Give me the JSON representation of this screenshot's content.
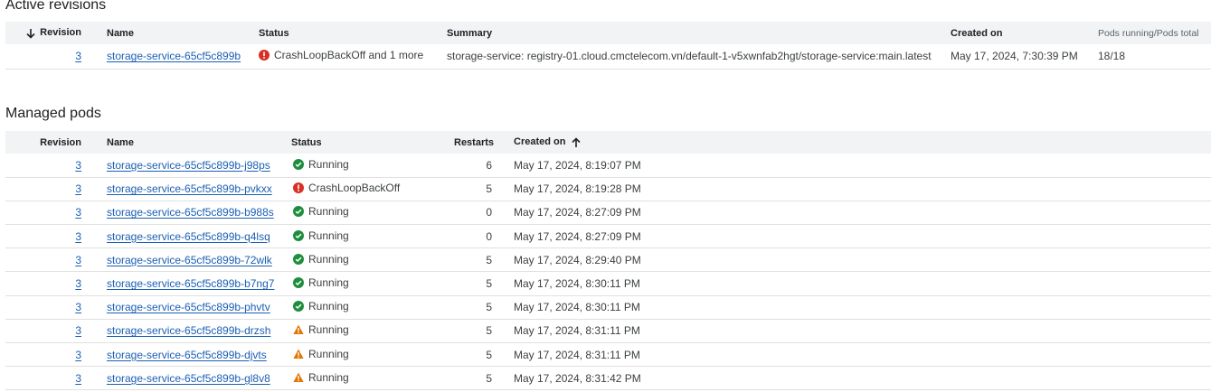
{
  "active_revisions": {
    "title": "Active revisions",
    "headers": {
      "revision": "Revision",
      "name": "Name",
      "status": "Status",
      "summary": "Summary",
      "created_on": "Created on",
      "pods": "Pods running/Pods total"
    },
    "rows": [
      {
        "revision": "3",
        "name": "storage-service-65cf5c899b",
        "status": "CrashLoopBackOff and 1 more",
        "status_icon": "error-icon",
        "summary": "storage-service: registry-01.cloud.cmctelecom.vn/default-1-v5xwnfab2hgt/storage-service:main.latest",
        "created_on": "May 17, 2024, 7:30:39 PM",
        "pods": "18/18"
      }
    ]
  },
  "managed_pods": {
    "title": "Managed pods",
    "headers": {
      "revision": "Revision",
      "name": "Name",
      "status": "Status",
      "restarts": "Restarts",
      "created_on": "Created on"
    },
    "rows": [
      {
        "revision": "3",
        "name": "storage-service-65cf5c899b-j98ps",
        "status": "Running",
        "status_icon": "check-circle-icon",
        "restarts": "6",
        "created_on": "May 17, 2024, 8:19:07 PM"
      },
      {
        "revision": "3",
        "name": "storage-service-65cf5c899b-pvkxx",
        "status": "CrashLoopBackOff",
        "status_icon": "error-icon",
        "restarts": "5",
        "created_on": "May 17, 2024, 8:19:28 PM"
      },
      {
        "revision": "3",
        "name": "storage-service-65cf5c899b-b988s",
        "status": "Running",
        "status_icon": "check-circle-icon",
        "restarts": "0",
        "created_on": "May 17, 2024, 8:27:09 PM"
      },
      {
        "revision": "3",
        "name": "storage-service-65cf5c899b-q4lsq",
        "status": "Running",
        "status_icon": "check-circle-icon",
        "restarts": "0",
        "created_on": "May 17, 2024, 8:27:09 PM"
      },
      {
        "revision": "3",
        "name": "storage-service-65cf5c899b-72wlk",
        "status": "Running",
        "status_icon": "check-circle-icon",
        "restarts": "5",
        "created_on": "May 17, 2024, 8:29:40 PM"
      },
      {
        "revision": "3",
        "name": "storage-service-65cf5c899b-b7ng7",
        "status": "Running",
        "status_icon": "check-circle-icon",
        "restarts": "5",
        "created_on": "May 17, 2024, 8:30:11 PM"
      },
      {
        "revision": "3",
        "name": "storage-service-65cf5c899b-phvtv",
        "status": "Running",
        "status_icon": "check-circle-icon",
        "restarts": "5",
        "created_on": "May 17, 2024, 8:30:11 PM"
      },
      {
        "revision": "3",
        "name": "storage-service-65cf5c899b-drzsh",
        "status": "Running",
        "status_icon": "warning-icon",
        "restarts": "5",
        "created_on": "May 17, 2024, 8:31:11 PM"
      },
      {
        "revision": "3",
        "name": "storage-service-65cf5c899b-djvts",
        "status": "Running",
        "status_icon": "warning-icon",
        "restarts": "5",
        "created_on": "May 17, 2024, 8:31:11 PM"
      },
      {
        "revision": "3",
        "name": "storage-service-65cf5c899b-gl8v8",
        "status": "Running",
        "status_icon": "warning-icon",
        "restarts": "5",
        "created_on": "May 17, 2024, 8:31:42 PM"
      }
    ]
  },
  "colors": {
    "link": "#1a5fb4",
    "success": "#1e8e3e",
    "error": "#d93025",
    "warning": "#e37400",
    "header_bg": "#f1f3f4"
  }
}
